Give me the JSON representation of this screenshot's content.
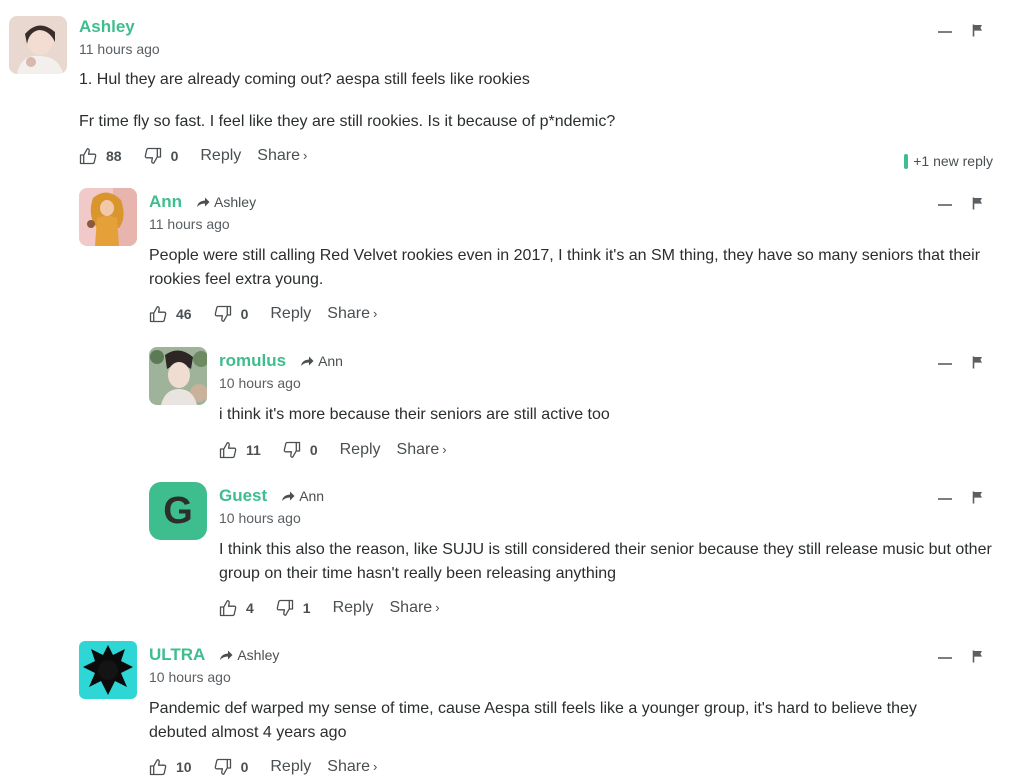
{
  "colors": {
    "accent": "#3ebd8e",
    "text": "#2a2e2e",
    "muted": "#4a4f52"
  },
  "new_reply_label": "+1 new reply",
  "comments": [
    {
      "author": "Ashley",
      "time": "11 hours ago",
      "paragraphs": [
        "1. Hul they are already coming out? aespa still feels like rookies",
        "Fr time fly so fast. I feel like they are still rookies. Is it because of p*ndemic?"
      ],
      "upvotes": "88",
      "downvotes": "0",
      "reply_label": "Reply",
      "share_label": "Share",
      "share_chevron": "›"
    },
    {
      "author": "Ann",
      "reply_to": "Ashley",
      "time": "11 hours ago",
      "paragraphs": [
        "People were still calling Red Velvet rookies even in 2017, I think it's an SM thing, they have so many seniors that their rookies feel extra young."
      ],
      "upvotes": "46",
      "downvotes": "0",
      "reply_label": "Reply",
      "share_label": "Share",
      "share_chevron": "›"
    },
    {
      "author": "romulus",
      "reply_to": "Ann",
      "time": "10 hours ago",
      "paragraphs": [
        "i think it's more because their seniors are still active too"
      ],
      "upvotes": "11",
      "downvotes": "0",
      "reply_label": "Reply",
      "share_label": "Share",
      "share_chevron": "›"
    },
    {
      "author": "Guest",
      "avatar_letter": "G",
      "reply_to": "Ann",
      "time": "10 hours ago",
      "paragraphs": [
        "I think this also the reason, like SUJU is still considered their senior because they still release music but other group on their time hasn't really been releasing anything"
      ],
      "upvotes": "4",
      "downvotes": "1",
      "reply_label": "Reply",
      "share_label": "Share",
      "share_chevron": "›"
    },
    {
      "author": "ULTRA",
      "reply_to": "Ashley",
      "time": "10 hours ago",
      "paragraphs": [
        "Pandemic def warped my sense of time, cause Aespa still feels like a younger group, it's hard to believe they debuted almost 4 years ago"
      ],
      "upvotes": "10",
      "downvotes": "0",
      "reply_label": "Reply",
      "share_label": "Share",
      "share_chevron": "›"
    }
  ]
}
